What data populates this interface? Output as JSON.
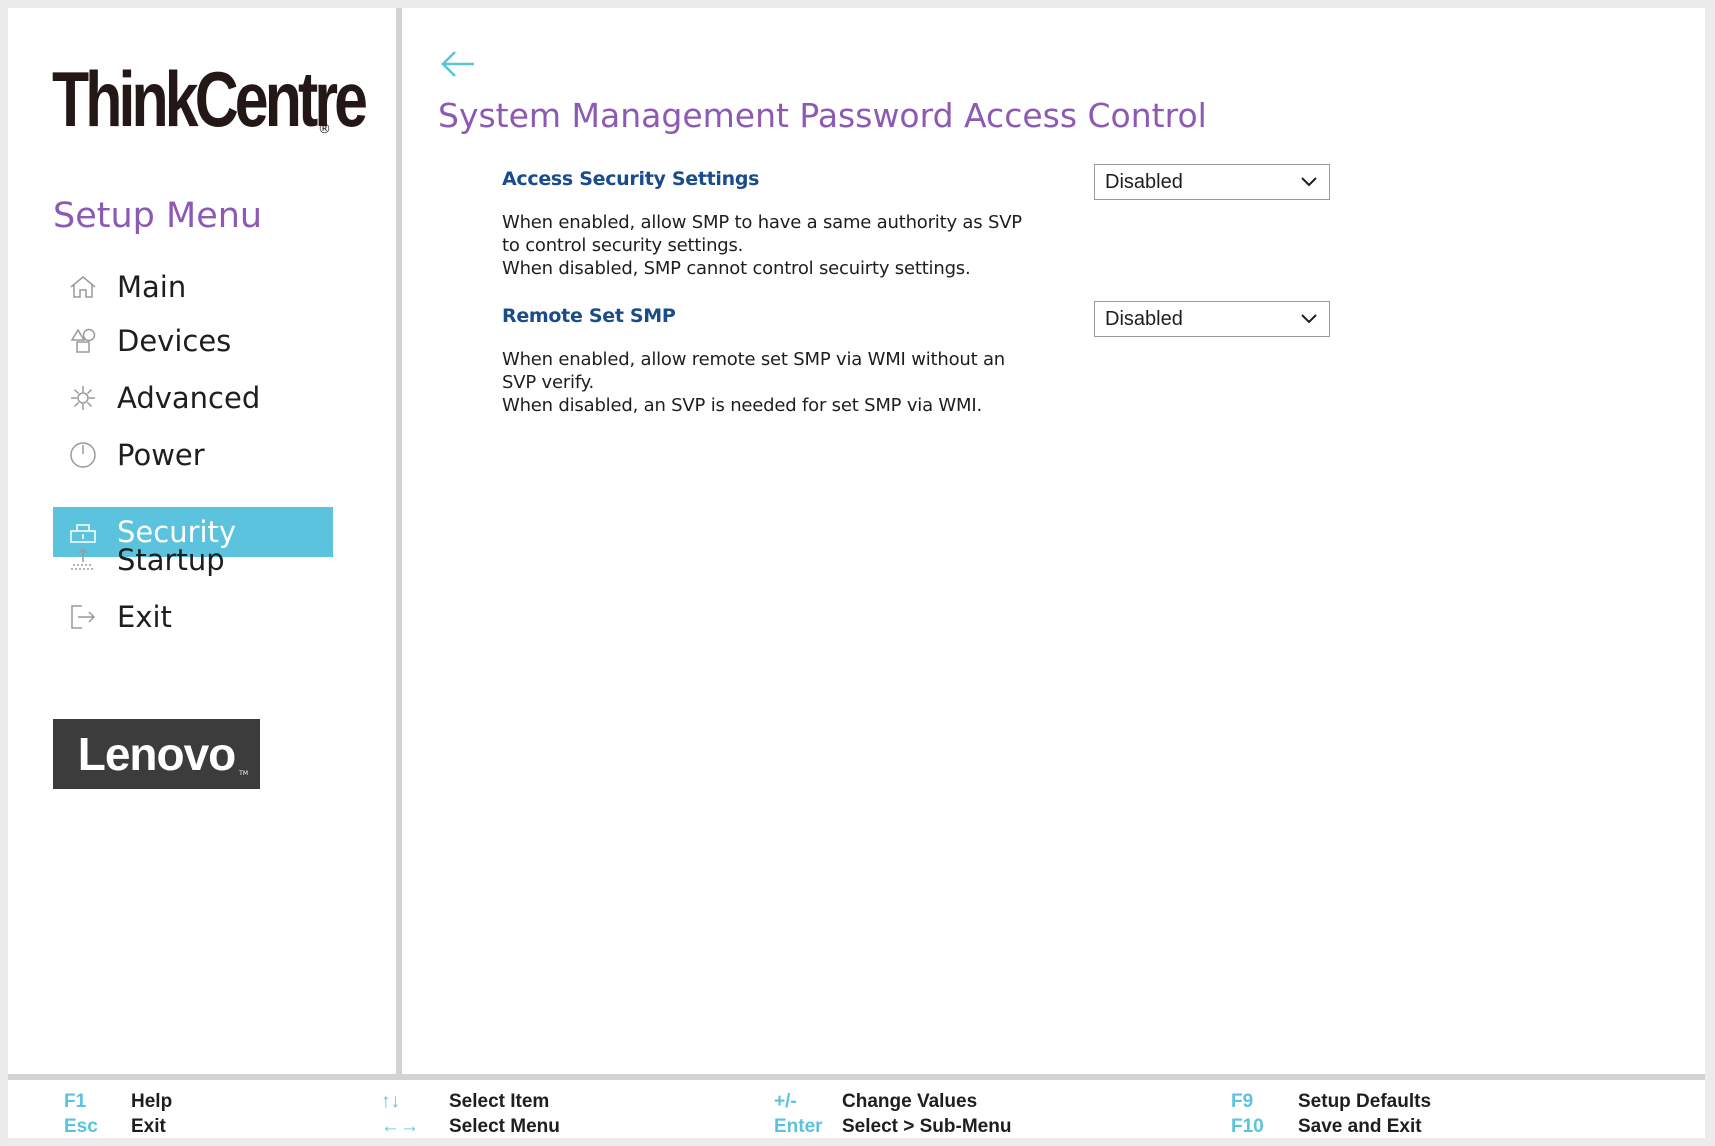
{
  "brand": {
    "name": "ThinkCentre",
    "mark": "®"
  },
  "sidebar": {
    "title": "Setup Menu",
    "items": [
      {
        "label": "Main",
        "icon": "home-icon",
        "active": false
      },
      {
        "label": "Devices",
        "icon": "devices-icon",
        "active": false
      },
      {
        "label": "Advanced",
        "icon": "advanced-icon",
        "active": false
      },
      {
        "label": "Power",
        "icon": "power-icon",
        "active": false
      },
      {
        "label": "Security",
        "icon": "lock-icon",
        "active": true
      },
      {
        "label": "Startup",
        "icon": "startup-icon",
        "active": false
      },
      {
        "label": "Exit",
        "icon": "exit-icon",
        "active": false
      }
    ],
    "logo": {
      "text": "Lenovo",
      "tm": "TM"
    }
  },
  "page": {
    "title": "System Management Password Access Control",
    "settings": [
      {
        "title": "Access Security Settings",
        "value": "Disabled",
        "description": [
          "When enabled, allow SMP to have a same authority as SVP",
          "to control security settings.",
          "When disabled, SMP cannot control secuirty settings."
        ]
      },
      {
        "title": "Remote Set SMP",
        "value": "Disabled",
        "description": [
          "When enabled, allow remote set SMP via WMI without an",
          "SVP verify.",
          "When disabled, an SVP is needed for set SMP via WMI."
        ]
      }
    ]
  },
  "footer": {
    "f1_key": "F1",
    "f1_label": "Help",
    "esc_key": "Esc",
    "esc_label": "Exit",
    "updown_key": "↑↓",
    "updown_label": "Select Item",
    "leftright_key": "←→",
    "leftright_label": "Select Menu",
    "plusminus_key": "+/-",
    "plusminus_label": "Change Values",
    "enter_key": "Enter",
    "enter_label": "Select > Sub-Menu",
    "f9_key": "F9",
    "f9_label": "Setup Defaults",
    "f10_key": "F10",
    "f10_label": "Save and Exit"
  },
  "colors": {
    "accent": "#5bc3dd",
    "title_purple": "#8c5ab4",
    "setting_blue": "#1a4c8c"
  }
}
